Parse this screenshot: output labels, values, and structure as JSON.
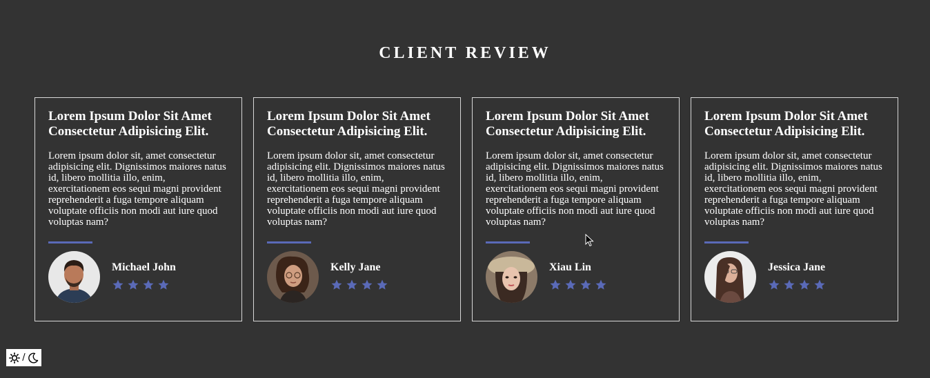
{
  "section": {
    "title": "CLIENT REVIEW"
  },
  "reviews": [
    {
      "title": "Lorem Ipsum Dolor Sit Amet Consectetur Adipisicing Elit.",
      "text": "Lorem ipsum dolor sit, amet consectetur adipisicing elit. Dignissimos maiores natus id, libero mollitia illo, enim, exercitationem eos sequi magni provident reprehenderit a fuga tempore aliquam voluptate officiis non modi aut iure quod voluptas nam?",
      "name": "Michael John",
      "rating": 4
    },
    {
      "title": "Lorem Ipsum Dolor Sit Amet Consectetur Adipisicing Elit.",
      "text": "Lorem ipsum dolor sit, amet consectetur adipisicing elit. Dignissimos maiores natus id, libero mollitia illo, enim, exercitationem eos sequi magni provident reprehenderit a fuga tempore aliquam voluptate officiis non modi aut iure quod voluptas nam?",
      "name": "Kelly Jane",
      "rating": 4
    },
    {
      "title": "Lorem Ipsum Dolor Sit Amet Consectetur Adipisicing Elit.",
      "text": "Lorem ipsum dolor sit, amet consectetur adipisicing elit. Dignissimos maiores natus id, libero mollitia illo, enim, exercitationem eos sequi magni provident reprehenderit a fuga tempore aliquam voluptate officiis non modi aut iure quod voluptas nam?",
      "name": "Xiau Lin",
      "rating": 4
    },
    {
      "title": "Lorem Ipsum Dolor Sit Amet Consectetur Adipisicing Elit.",
      "text": "Lorem ipsum dolor sit, amet consectetur adipisicing elit. Dignissimos maiores natus id, libero mollitia illo, enim, exercitationem eos sequi magni provident reprehenderit a fuga tempore aliquam voluptate officiis non modi aut iure quod voluptas nam?",
      "name": "Jessica Jane",
      "rating": 4
    }
  ],
  "theme_toggle": {
    "separator": "/",
    "light_icon": "sun-icon",
    "dark_icon": "moon-icon"
  },
  "colors": {
    "background": "#333333",
    "accent": "#5a6ab8",
    "card_border": "#d9d9d9",
    "text": "#ffffff"
  }
}
